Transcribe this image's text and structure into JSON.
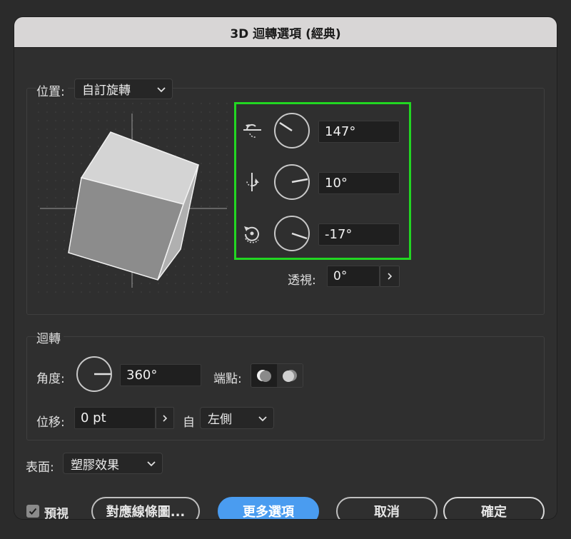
{
  "window": {
    "title": "3D 迴轉選項 (經典)"
  },
  "position": {
    "label": "位置:",
    "preset": "自訂旋轉",
    "x_angle": "147°",
    "y_angle": "10°",
    "z_angle": "-17°",
    "perspective_label": "透視:",
    "perspective_value": "0°"
  },
  "revolve": {
    "section_label": "迴轉",
    "angle_label": "角度:",
    "angle_value": "360°",
    "cap_label": "端點:",
    "offset_label": "位移:",
    "offset_value": "0 pt",
    "from_label": "自",
    "from_value": "左側"
  },
  "surface": {
    "label": "表面:",
    "value": "塑膠效果"
  },
  "footer": {
    "preview_label": "預視",
    "preview_checked": true,
    "map_art_label": "對應線條圖...",
    "more_options_label": "更多選項",
    "cancel_label": "取消",
    "ok_label": "確定"
  },
  "colors": {
    "highlight": "#22d622",
    "primary_button": "#4a9cf0",
    "cube_face_top": "#d4d4d4",
    "cube_face_front": "#8c8c8c",
    "cube_face_side": "#b0b0b0"
  }
}
